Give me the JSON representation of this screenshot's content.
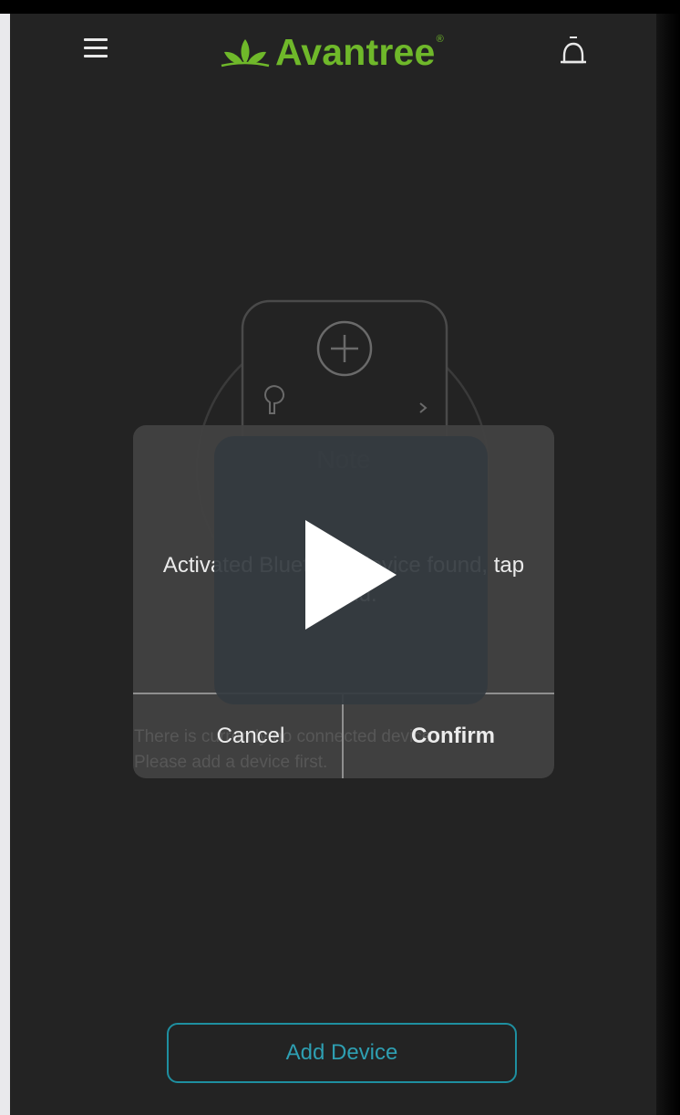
{
  "app": {
    "brand_name": "Avantree",
    "brand_mark": "®",
    "accent_color": "#6fb82a",
    "background_color": "#232323",
    "menu_icon": "hamburger-menu-icon",
    "bell_icon": "bell-icon",
    "logo_icon": "leaf-logo-icon"
  },
  "dialog": {
    "title": "Note",
    "message": "Activated Bluetooth device found, tap to add.",
    "cancel_label": "Cancel",
    "confirm_label": "Confirm"
  },
  "background_text": {
    "empty_line1": "There is currently no connected device.",
    "empty_line2": "Please add a device first."
  },
  "video_overlay": {
    "icon": "play-icon"
  },
  "footer": {
    "add_device_label": "Add Device",
    "button_color": "#1e8fa0"
  }
}
